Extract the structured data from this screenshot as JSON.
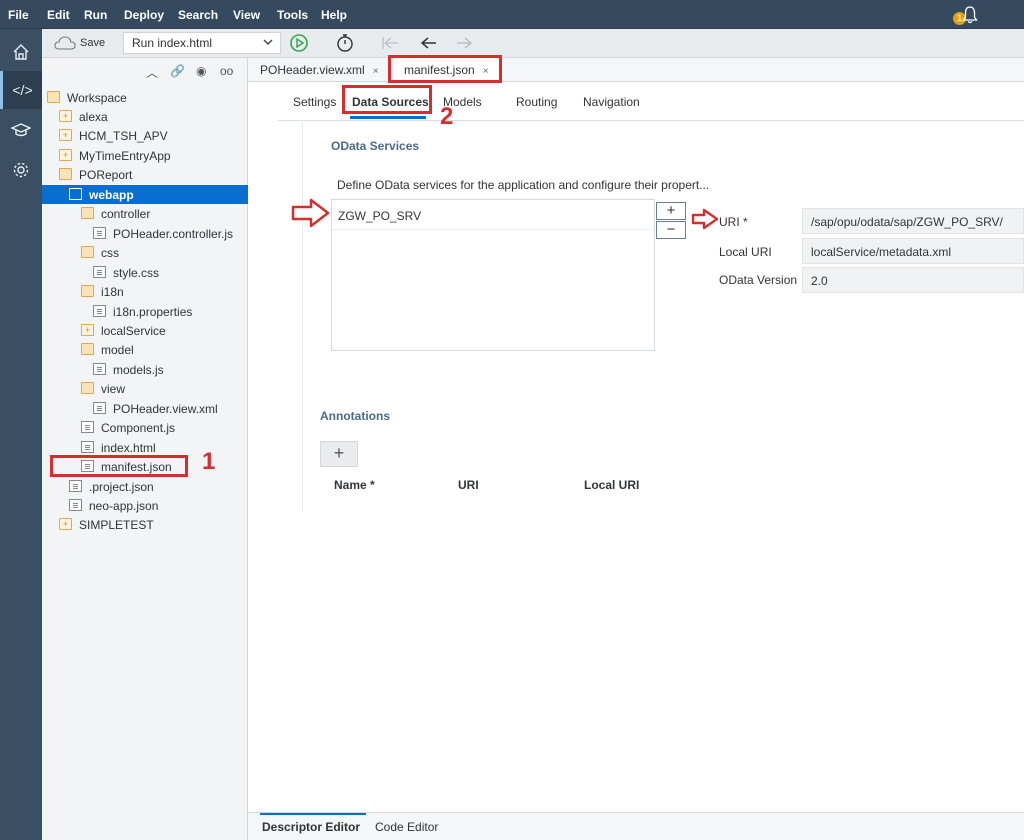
{
  "menubar": {
    "items": [
      "File",
      "Edit",
      "Run",
      "Deploy",
      "Search",
      "View",
      "Tools",
      "Help"
    ],
    "notification_count": "1"
  },
  "toolbar": {
    "save_label": "Save",
    "run_config": "Run index.html"
  },
  "tree": {
    "root": "Workspace",
    "items": [
      {
        "label": "alexa",
        "kind": "folder"
      },
      {
        "label": "HCM_TSH_APV",
        "kind": "folder"
      },
      {
        "label": "MyTimeEntryApp",
        "kind": "folder"
      },
      {
        "label": "POReport",
        "kind": "folder-open"
      },
      {
        "label": "webapp",
        "kind": "folder-open"
      },
      {
        "label": "controller",
        "kind": "folder-open"
      },
      {
        "label": "POHeader.controller.js",
        "kind": "file"
      },
      {
        "label": "css",
        "kind": "folder-open"
      },
      {
        "label": "style.css",
        "kind": "file"
      },
      {
        "label": "i18n",
        "kind": "folder-open"
      },
      {
        "label": "i18n.properties",
        "kind": "file"
      },
      {
        "label": "localService",
        "kind": "folder"
      },
      {
        "label": "model",
        "kind": "folder-open"
      },
      {
        "label": "models.js",
        "kind": "file"
      },
      {
        "label": "view",
        "kind": "folder-open"
      },
      {
        "label": "POHeader.view.xml",
        "kind": "file"
      },
      {
        "label": "Component.js",
        "kind": "file"
      },
      {
        "label": "index.html",
        "kind": "file"
      },
      {
        "label": "manifest.json",
        "kind": "file"
      },
      {
        "label": ".project.json",
        "kind": "file"
      },
      {
        "label": "neo-app.json",
        "kind": "file"
      },
      {
        "label": "SIMPLETEST",
        "kind": "folder"
      }
    ],
    "selected": "webapp"
  },
  "editor_tabs": [
    {
      "label": "POHeader.view.xml",
      "close": "×"
    },
    {
      "label": "manifest.json",
      "close": "×"
    }
  ],
  "descriptor_tabs": [
    "Settings",
    "Data Sources",
    "Models",
    "Routing",
    "Navigation"
  ],
  "active_descriptor_tab": "Data Sources",
  "odata": {
    "heading": "OData Services",
    "description": "Define OData services for the application and configure their propert...",
    "services": [
      "ZGW_PO_SRV"
    ],
    "add_label": "+",
    "remove_label": "−",
    "fields": [
      {
        "label": "URI *",
        "value": "/sap/opu/odata/sap/ZGW_PO_SRV/"
      },
      {
        "label": "Local URI",
        "value": "localService/metadata.xml"
      },
      {
        "label": "OData Version",
        "value": "2.0"
      }
    ]
  },
  "annotations": {
    "heading": "Annotations",
    "add_label": "+",
    "columns": [
      "Name *",
      "URI",
      "Local URI"
    ]
  },
  "bottom_tabs": [
    "Descriptor Editor",
    "Code Editor"
  ],
  "callouts": {
    "step1": "1",
    "step2": "2"
  },
  "colors": {
    "menubar": "#354a5f",
    "rail": "#3b4f63",
    "selection": "#0a6ed1",
    "callout": "#d32f2f"
  }
}
